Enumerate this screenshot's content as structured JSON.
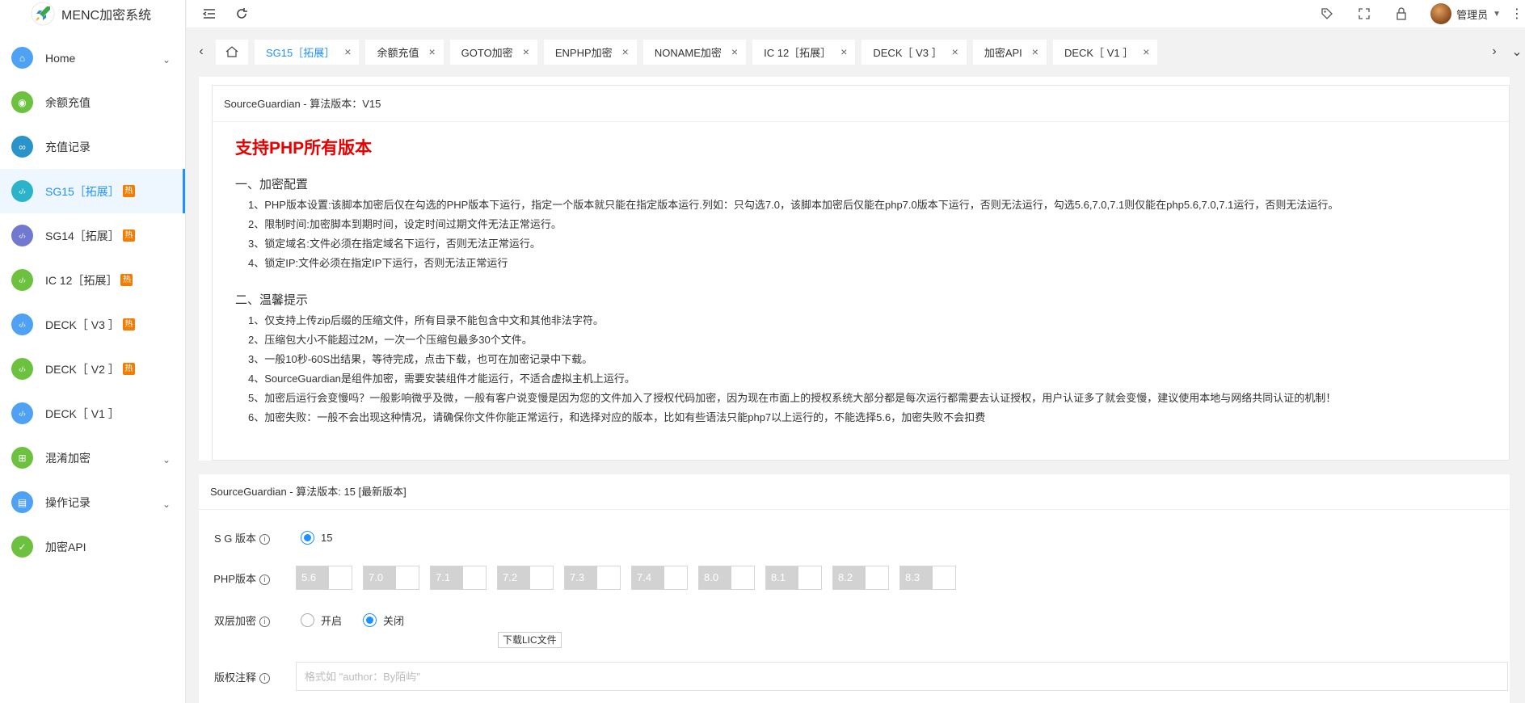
{
  "app": {
    "title": "MENC加密系统"
  },
  "sidebar": {
    "items": [
      {
        "label": "Home",
        "icon": "home-icon",
        "color": "#4ea1f3",
        "hot": false,
        "expand": true
      },
      {
        "label": "余额充值",
        "icon": "recharge-icon",
        "color": "#6cc23f",
        "hot": false,
        "expand": false
      },
      {
        "label": "充值记录",
        "icon": "record-icon",
        "color": "#2a93c9",
        "hot": false,
        "expand": false
      },
      {
        "label": "SG15［拓展］",
        "icon": "code-icon",
        "color": "#2bb3c9",
        "hot": true,
        "expand": false,
        "active": true
      },
      {
        "label": "SG14［拓展］",
        "icon": "code-icon",
        "color": "#7079cf",
        "hot": true,
        "expand": false
      },
      {
        "label": "IC 12［拓展］",
        "icon": "code-icon",
        "color": "#6cc23f",
        "hot": true,
        "expand": false
      },
      {
        "label": "DECK［ V3 ］",
        "icon": "code-icon",
        "color": "#4ea1f3",
        "hot": true,
        "expand": false
      },
      {
        "label": "DECK［ V2 ］",
        "icon": "code-icon",
        "color": "#6cc23f",
        "hot": true,
        "expand": false
      },
      {
        "label": "DECK［ V1 ］",
        "icon": "code-icon",
        "color": "#4ea1f3",
        "hot": false,
        "expand": false
      },
      {
        "label": "混淆加密",
        "icon": "cart-icon",
        "color": "#6cc23f",
        "hot": false,
        "expand": true
      },
      {
        "label": "操作记录",
        "icon": "log-icon",
        "color": "#4ea1f3",
        "hot": false,
        "expand": true
      },
      {
        "label": "加密API",
        "icon": "shield-icon",
        "color": "#6cc23f",
        "hot": false,
        "expand": false
      }
    ],
    "hot_badge": "热"
  },
  "topbar": {
    "user": "管理员"
  },
  "tabs": [
    {
      "label": "SG15［拓展］",
      "active": true
    },
    {
      "label": "余额充值"
    },
    {
      "label": "GOTO加密"
    },
    {
      "label": "ENPHP加密"
    },
    {
      "label": "NONAME加密"
    },
    {
      "label": "IC 12［拓展］"
    },
    {
      "label": "DECK［ V3 ］"
    },
    {
      "label": "加密API"
    },
    {
      "label": "DECK［ V1 ］"
    }
  ],
  "info_panel": {
    "header": "SourceGuardian - 算法版本：V15",
    "title": "支持PHP所有版本",
    "section1_title": "一、加密配置",
    "section1_lines": [
      "1、PHP版本设置:该脚本加密后仅在勾选的PHP版本下运行，指定一个版本就只能在指定版本运行.列如：只勾选7.0，该脚本加密后仅能在php7.0版本下运行，否则无法运行，勾选5.6,7.0,7.1则仅能在php5.6,7.0,7.1运行，否则无法运行。",
      "2、限制时间:加密脚本到期时间，设定时间过期文件无法正常运行。",
      "3、锁定域名:文件必须在指定域名下运行，否则无法正常运行。",
      "4、锁定IP:文件必须在指定IP下运行，否则无法正常运行"
    ],
    "section2_title": "二、温馨提示",
    "section2_lines": [
      "1、仅支持上传zip后缀的压缩文件，所有目录不能包含中文和其他非法字符。",
      "2、压缩包大小不能超过2M，一次一个压缩包最多30个文件。",
      "3、一般10秒-60S出结果，等待完成，点击下载，也可在加密记录中下载。",
      "4、SourceGuardian是组件加密，需要安装组件才能运行，不适合虚拟主机上运行。",
      "5、加密后运行会变慢吗？一般影响微乎及微，一般有客户说变慢是因为您的文件加入了授权代码加密，因为现在市面上的授权系统大部分都是每次运行都需要去认证授权，用户认证多了就会变慢，建议使用本地与网络共同认证的机制！",
      "6、加密失败：一般不会出现这种情况，请确保你文件你能正常运行，和选择对应的版本，比如有些语法只能php7以上运行的，不能选择5.6，加密失败不会扣费"
    ]
  },
  "form": {
    "header": "SourceGuardian - 算法版本: 15 [最新版本]",
    "sg_label": "S G 版本",
    "sg_value": "15",
    "php_label": "PHP版本",
    "php_versions": [
      "5.6",
      "7.0",
      "7.1",
      "7.2",
      "7.3",
      "7.4",
      "8.0",
      "8.1",
      "8.2",
      "8.3"
    ],
    "double_label": "双层加密",
    "opt_on": "开启",
    "opt_off": "关闭",
    "double_selected": "关闭",
    "lic_button": "下载LIC文件",
    "copyright_label": "版权注释",
    "copyright_placeholder": "格式如 \"author：By陌屿\""
  }
}
